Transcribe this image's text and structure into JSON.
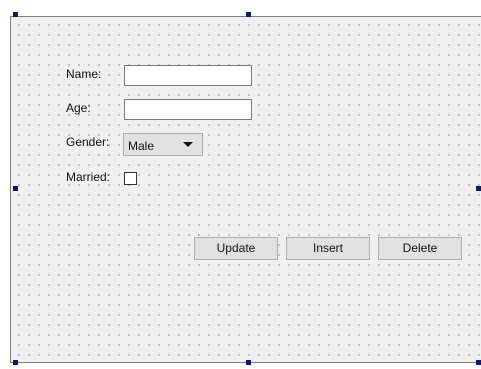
{
  "form": {
    "name_label": "Name:",
    "name_value": "",
    "age_label": "Age:",
    "age_value": "",
    "gender_label": "Gender:",
    "gender_selected": "Male",
    "married_label": "Married:",
    "married_checked": false
  },
  "buttons": {
    "update_label": "Update",
    "insert_label": "Insert",
    "delete_label": "Delete"
  },
  "icons": {
    "dropdown_arrow": "chevron-down-icon"
  },
  "colors": {
    "surface": "#f0f0f0",
    "grid_dot": "#9a9a9a",
    "selection_handle": "#0a1a6a",
    "button_face": "#e1e1e1"
  }
}
